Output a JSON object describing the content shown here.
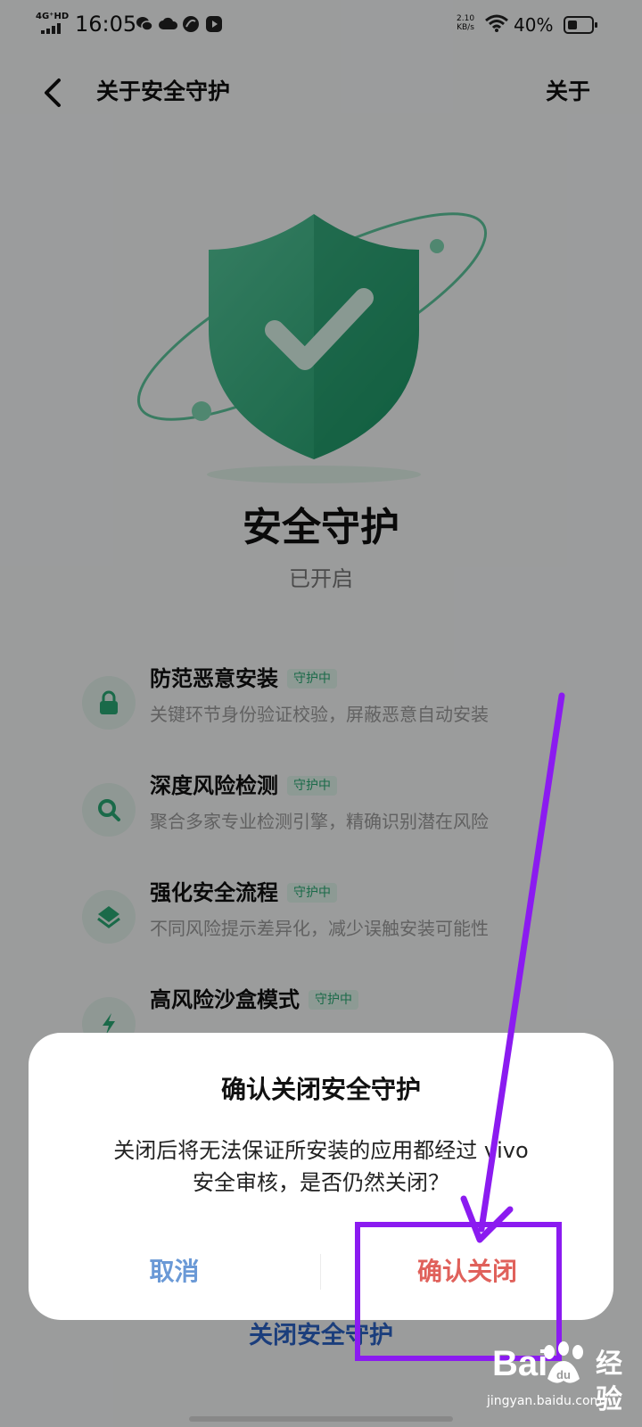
{
  "status_bar": {
    "network": "4G⁺HD",
    "time": "16:05",
    "net_speed_value": "2.10",
    "net_speed_unit": "KB/s",
    "battery": "40%",
    "battery_level": 0.4
  },
  "header": {
    "title": "关于安全守护",
    "about_label": "关于"
  },
  "hero": {
    "title": "安全守护",
    "status": "已开启"
  },
  "features": [
    {
      "icon": "lock-icon",
      "title": "防范恶意安装",
      "badge": "守护中",
      "desc": "关键环节身份验证校验，屏蔽恶意自动安装"
    },
    {
      "icon": "search-icon",
      "title": "深度风险检测",
      "badge": "守护中",
      "desc": "聚合多家专业检测引擎，精确识别潜在风险"
    },
    {
      "icon": "layers-icon",
      "title": "强化安全流程",
      "badge": "守护中",
      "desc": "不同风险提示差异化，减少误触安装可能性"
    },
    {
      "icon": "sandbox-icon",
      "title": "高风险沙盒模式",
      "badge": "守护中",
      "desc": ""
    }
  ],
  "bottom_link": "关闭安全守护",
  "dialog": {
    "title": "确认关闭安全守护",
    "body_line1": "关闭后将无法保证所安装的应用都经过 vivo",
    "body_line2": "安全审核，是否仍然关闭？",
    "cancel_label": "取消",
    "confirm_label": "确认关闭"
  },
  "watermark": {
    "logo": "Bai",
    "logo_suffix": "经验",
    "url": "jingyan.baidu.com"
  },
  "colors": {
    "accent_green": "#2aa874",
    "link_blue": "#2b62c4",
    "danger_red": "#e0615b",
    "annotation_purple": "#8b1bf0"
  }
}
